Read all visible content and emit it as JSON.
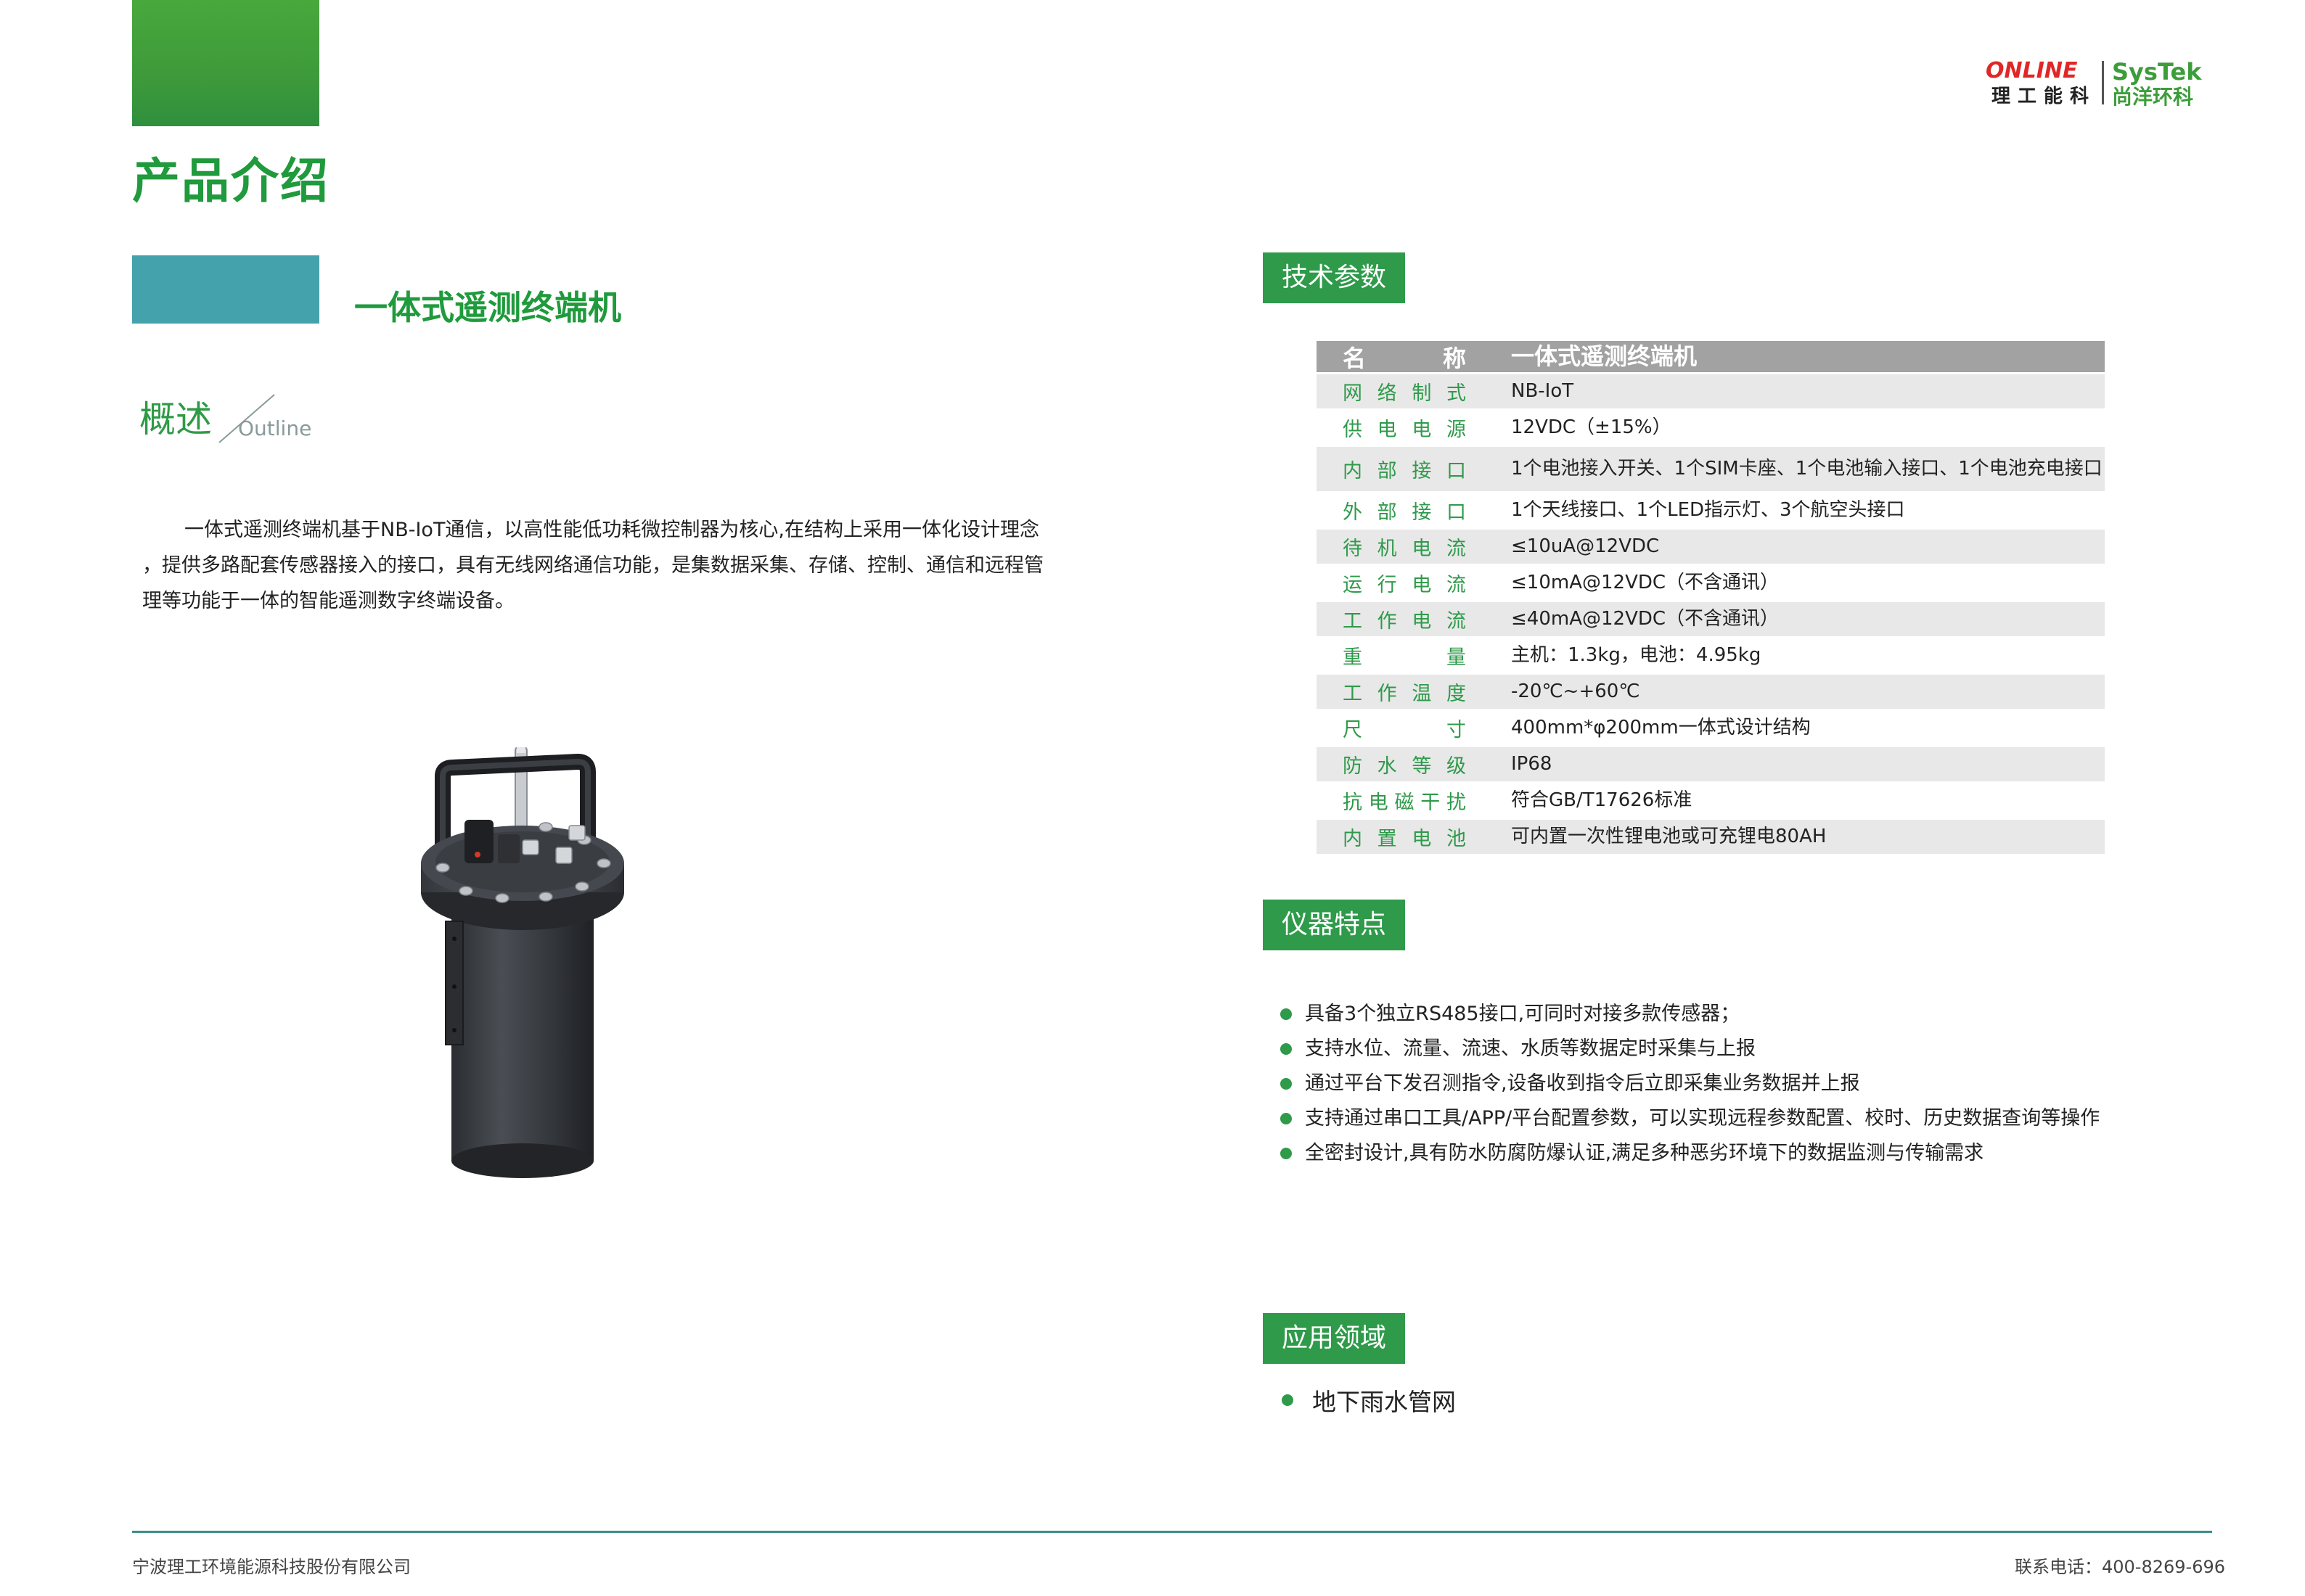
{
  "header": {
    "page_title": "产品介绍",
    "product_name": "一体式遥测终端机",
    "outline_zh": "概述",
    "outline_en": "Outline"
  },
  "logo": {
    "online_prefix": "ONLINE",
    "online_zh": "理工能科",
    "systek": "SysTek",
    "systek_zh": "尚洋环科"
  },
  "intro": {
    "lines": [
      "一体式遥测终端机基于NB-IoT通信，以高性能低功耗微控制器为核心,在结构上采用一体化设计理念",
      "，提供多路配套传感器接入的接口，具有无线网络通信功能，是集数据采集、存储、控制、通信和远程管",
      "理等功能于一体的智能遥测数字终端设备。"
    ]
  },
  "spec": {
    "tag": "技术参数",
    "header_key": [
      "名",
      "称"
    ],
    "header_value": "一体式遥测终端机",
    "rows": [
      {
        "key": [
          "网",
          "络",
          "制",
          "式"
        ],
        "value": "NB-IoT"
      },
      {
        "key": [
          "供",
          "电",
          "电",
          "源"
        ],
        "value": "12VDC（±15%）"
      },
      {
        "key": [
          "内",
          "部",
          "接",
          "口"
        ],
        "value": "1个电池接入开关、1个SIM卡座、1个电池输入接口、1个电池充电接口"
      },
      {
        "key": [
          "外",
          "部",
          "接",
          "口"
        ],
        "value": "1个天线接口、1个LED指示灯、3个航空头接口"
      },
      {
        "key": [
          "待",
          "机",
          "电",
          "流"
        ],
        "value": "≤10uA@12VDC"
      },
      {
        "key": [
          "运",
          "行",
          "电",
          "流"
        ],
        "value": "≤10mA@12VDC（不含通讯）"
      },
      {
        "key": [
          "工",
          "作",
          "电",
          "流"
        ],
        "value": "≤40mA@12VDC（不含通讯）"
      },
      {
        "key": [
          "重",
          "量"
        ],
        "value": "主机：1.3kg，电池：4.95kg"
      },
      {
        "key": [
          "工",
          "作",
          "温",
          "度"
        ],
        "value": "-20℃~+60℃"
      },
      {
        "key": [
          "尺",
          "寸"
        ],
        "value": "400mm*φ200mm一体式设计结构"
      },
      {
        "key": [
          "防",
          "水",
          "等",
          "级"
        ],
        "value": "IP68"
      },
      {
        "key": [
          "抗",
          "电",
          "磁",
          "干",
          "扰"
        ],
        "value": "符合GB/T17626标准"
      },
      {
        "key": [
          "内",
          "置",
          "电",
          "池"
        ],
        "value": "可内置一次性锂电池或可充锂电80AH"
      }
    ]
  },
  "features": {
    "tag": "仪器特点",
    "items": [
      "具备3个独立RS485接口,可同时对接多款传感器；",
      "支持水位、流量、流速、水质等数据定时采集与上报",
      "通过平台下发召测指令,设备收到指令后立即采集业务数据并上报",
      "支持通过串口工具/APP/平台配置参数，可以实现远程参数配置、校时、历史数据查询等操作",
      "全密封设计,具有防水防腐防爆认证,满足多种恶劣环境下的数据监测与传输需求"
    ]
  },
  "application": {
    "tag": "应用领域",
    "item": "地下雨水管网"
  },
  "footer": {
    "company": "宁波理工环境能源科技股份有限公司",
    "phone": "联系电话：400-8269-696"
  },
  "colors": {
    "brand_green": "#2e9a4a",
    "teal": "#44a2ac",
    "table_header": "#a2a2a2",
    "table_stripe": "#e8e8e8"
  }
}
